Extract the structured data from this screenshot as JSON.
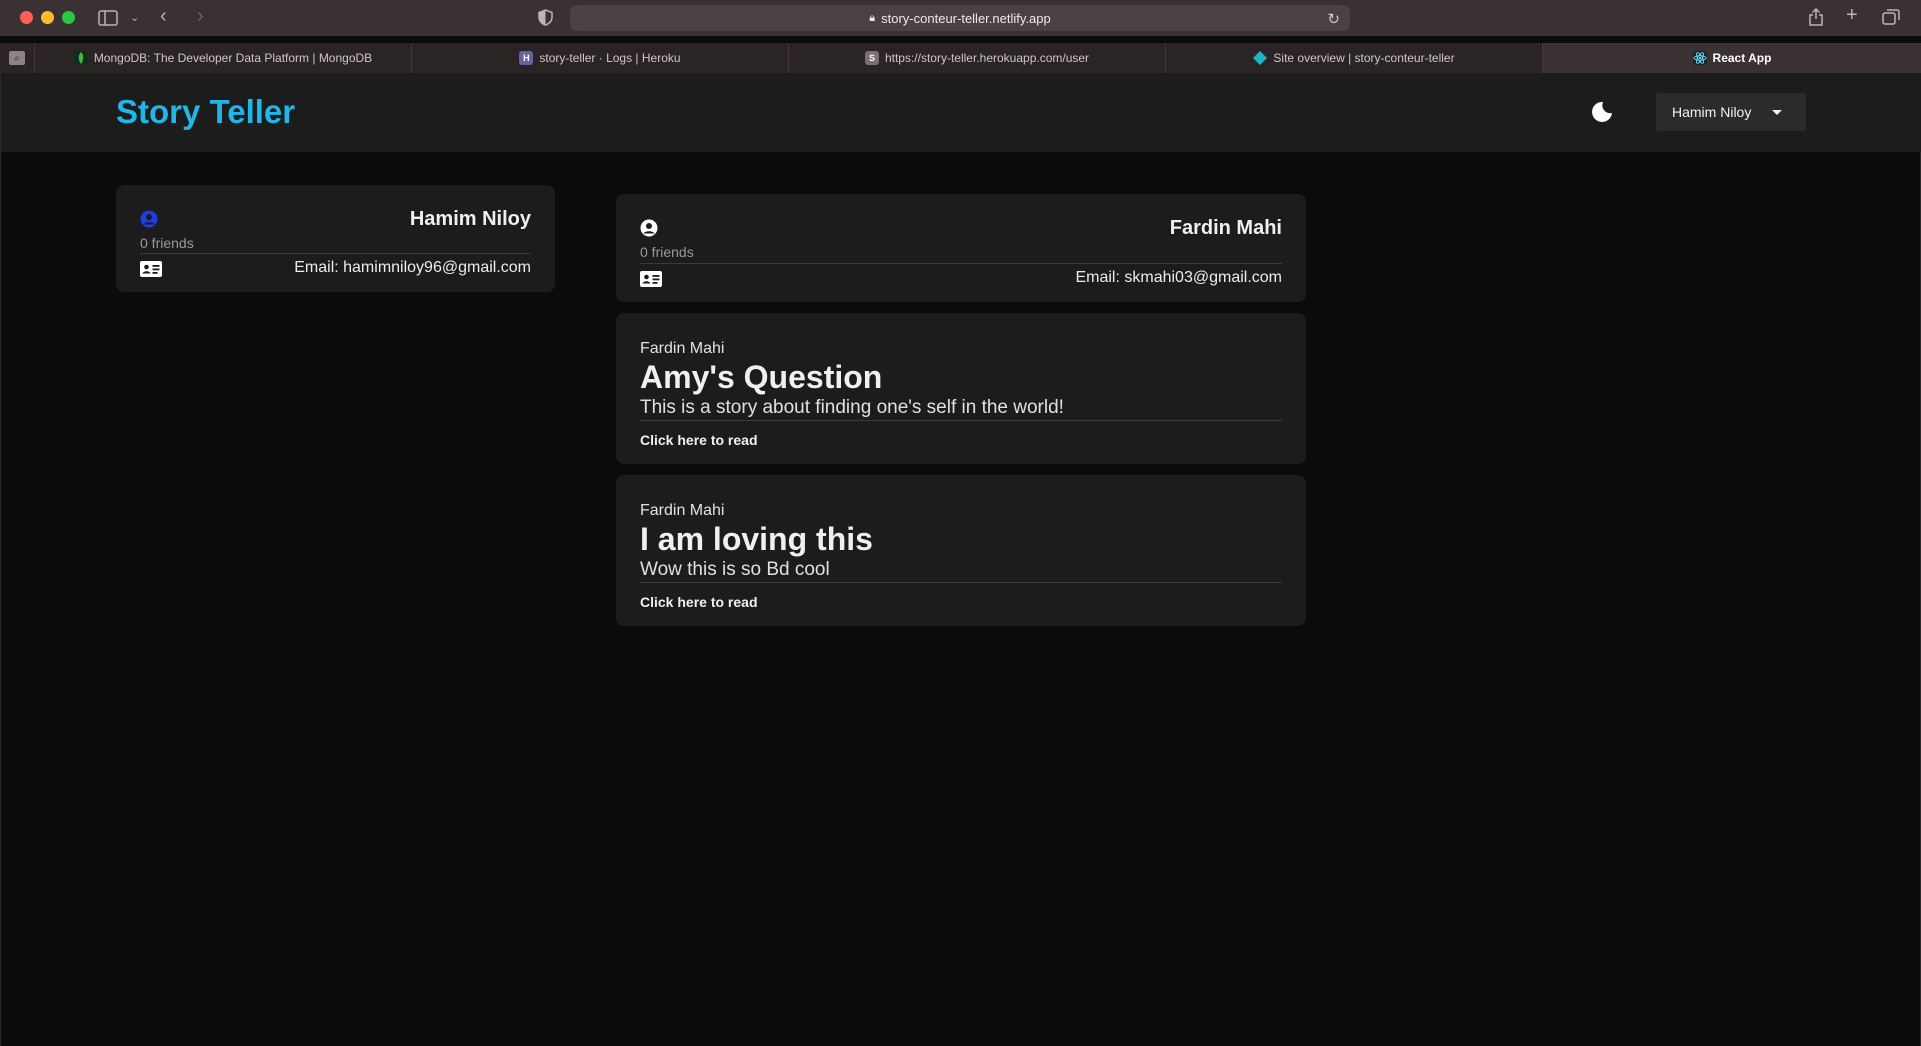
{
  "browser": {
    "url": "story-conteur-teller.netlify.app",
    "tabs": [
      {
        "label": "MongoDB: The Developer Data Platform | MongoDB",
        "icon": "mongodb-leaf-icon"
      },
      {
        "label": "story-teller · Logs | Heroku",
        "icon": "heroku-icon"
      },
      {
        "label": "https://story-teller.herokuapp.com/user",
        "icon": "letter-s-icon"
      },
      {
        "label": "Site overview | story-conteur-teller",
        "icon": "netlify-diamond-icon"
      },
      {
        "label": "React App",
        "icon": "react-atom-icon"
      }
    ],
    "favicon_letters": {
      "heroku": "H",
      "s": "S"
    }
  },
  "navbar": {
    "brand": "Story Teller",
    "user_menu_label": "Hamim Niloy",
    "theme_icon": "moon-icon"
  },
  "my_profile": {
    "name": "Hamim Niloy",
    "friends": "0 friends",
    "email": "Email: hamimniloy96@gmail.com",
    "icon_color": "#1f3ee0"
  },
  "viewed_profile": {
    "name": "Fardin Mahi",
    "friends": "0 friends",
    "email": "Email: skmahi03@gmail.com"
  },
  "stories": [
    {
      "author": "Fardin Mahi",
      "title": "Amy's Question",
      "description": "This is a story about finding one's self in the world!",
      "link": "Click here to read"
    },
    {
      "author": "Fardin Mahi",
      "title": "I am loving this",
      "description": "Wow this is so Bd cool",
      "link": "Click here to read"
    }
  ],
  "colors": {
    "brand": "#1fb6e8",
    "background": "#0b0b0b",
    "card": "#1c1c1c"
  }
}
